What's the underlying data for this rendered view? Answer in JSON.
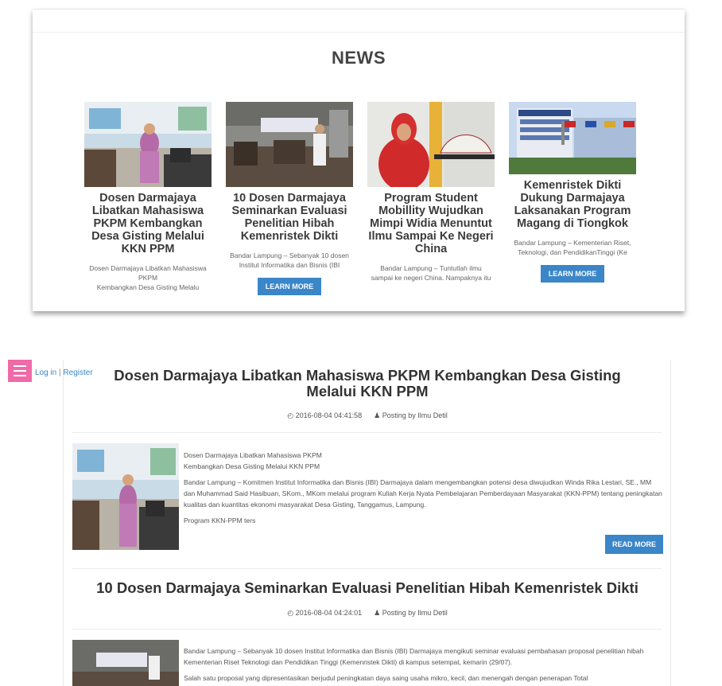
{
  "header": {
    "login_label": "Log in",
    "separator": "|",
    "register_label": "Register",
    "menu_icon": "hamburger-menu-icon",
    "menu_color": "#f06aa8",
    "accent": "#3a86c8"
  },
  "news": {
    "title": "NEWS",
    "cards": [
      {
        "title": "Dosen Darmajaya Libatkan Mahasiswa PKPM Kembangkan Desa Gisting Melalui KKN PPM",
        "excerpt_lines": [
          "Dosen Darmajaya Libatkan Mahasiswa",
          "PKPM",
          "Kembangkan Desa Gisting Melalu"
        ],
        "button": ""
      },
      {
        "title": "10 Dosen Darmajaya Seminarkan Evaluasi Penelitian Hibah Kemenristek Dikti",
        "excerpt_lines": [
          "Bandar Lampung – Sebanyak 10 dosen",
          "Institut Informatika dan Bisnis (IBI"
        ],
        "button": "LEARN MORE"
      },
      {
        "title": "Program Student Mobillity Wujudkan Mimpi Widia Menuntut Ilmu Sampai Ke Negeri China",
        "excerpt_lines": [
          "Bandar Lampung – Tuntutlah ilmu",
          "sampai ke negeri China. Nampaknya itu"
        ],
        "button": ""
      },
      {
        "title": "Kemenristek Dikti Dukung Darmajaya Laksanakan Program Magang di Tiongkok",
        "excerpt_lines": [
          "Bandar Lampung – Kementerian Riset,",
          "Teknologi, dan PendidikanTinggi (Ke"
        ],
        "button": "LEARN MORE"
      }
    ]
  },
  "posts": [
    {
      "title_lines": [
        "Dosen Darmajaya Libatkan Mahasiswa PKPM Kembangkan Desa Gisting",
        "Melalui KKN PPM"
      ],
      "date": "2016-08-04 04:41:58",
      "author": "Posting by Ilmu Detil",
      "clock_icon": "clock-icon",
      "user_icon": "user-icon",
      "paragraphs": [
        "Dosen Darmajaya Libatkan Mahasiswa PKPM",
        "Kembangkan Desa Gisting Melalui KKN PPM",
        "Bandar Lampung – Komitmen Institut Informatika dan Bisnis (IBI) Darmajaya dalam mengembangkan potensi desa diwujudkan Winda Rika Lestari, SE., MM dan Muhammad Said Hasibuan, SKom., MKom melalui program Kuliah Kerja Nyata Pembelajaran Pemberdayaan Masyarakat (KKN-PPM) tentang peningkatan kualitas dan kuantitas ekonomi masyarakat Desa Gisting, Tanggamus, Lampung.",
        "Program KKN-PPM ters"
      ],
      "button": "READ MORE"
    },
    {
      "title_lines": [
        "10 Dosen Darmajaya Seminarkan Evaluasi Penelitian Hibah Kemenristek Dikti"
      ],
      "date": "2016-08-04 04:24:01",
      "author": "Posting by Ilmu Detil",
      "paragraphs": [
        "Bandar Lampung – Sebanyak 10 dosen Institut Informatika dan Bisnis (IBI) Darmajaya mengikuti seminar evaluasi pembahasan proposal penelitian hibah Kementerian Riset Teknologi dan Pendidikan Tinggi (Kemenristek Dikti) di kampus setempat, kemarin (29/07).",
        "Salah satu proposal yang dipresentasikan berjudul peningkatan daya saing usaha mikro, kecil, dan menengah dengan penerapan Total"
      ]
    }
  ]
}
